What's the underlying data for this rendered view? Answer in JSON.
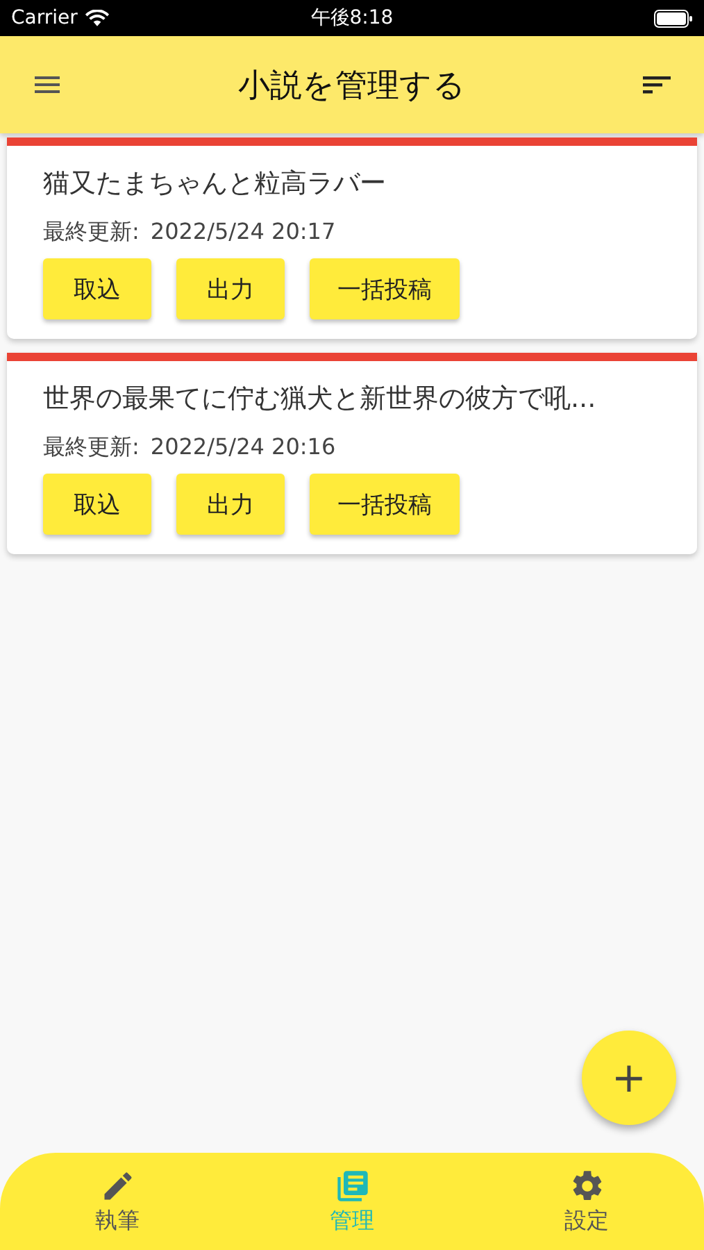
{
  "status_bar": {
    "carrier": "Carrier",
    "time": "午後8:18"
  },
  "header": {
    "title": "小説を管理する"
  },
  "novels": [
    {
      "title": "猫又たまちゃんと粒高ラバー",
      "updated_label": "最終更新:",
      "updated": "2022/5/24  20:17",
      "actions": [
        "取込",
        "出力",
        "一括投稿"
      ]
    },
    {
      "title": "世界の最果てに佇む猟犬と新世界の彼方で吼...",
      "updated_label": "最終更新:",
      "updated": "2022/5/24  20:16",
      "actions": [
        "取込",
        "出力",
        "一括投稿"
      ]
    }
  ],
  "fab": {
    "label": "+"
  },
  "tabs": [
    {
      "kind": "pencil",
      "label": "執筆",
      "selected": false
    },
    {
      "kind": "library",
      "label": "管理",
      "selected": true
    },
    {
      "kind": "gear",
      "label": "設定",
      "selected": false
    }
  ]
}
